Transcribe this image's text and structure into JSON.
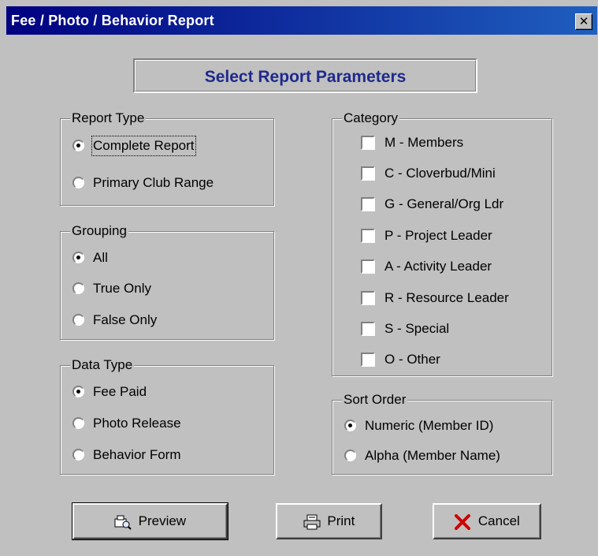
{
  "window": {
    "title": "Fee / Photo / Behavior Report",
    "close_glyph": "✕"
  },
  "heading": "Select Report Parameters",
  "report_type": {
    "legend": "Report Type",
    "options": [
      {
        "label": "Complete Report",
        "selected": true
      },
      {
        "label": "Primary Club Range",
        "selected": false
      }
    ]
  },
  "grouping": {
    "legend": "Grouping",
    "options": [
      {
        "label": "All",
        "selected": true
      },
      {
        "label": "True Only",
        "selected": false
      },
      {
        "label": "False Only",
        "selected": false
      }
    ]
  },
  "data_type": {
    "legend": "Data Type",
    "options": [
      {
        "label": "Fee Paid",
        "selected": true
      },
      {
        "label": "Photo Release",
        "selected": false
      },
      {
        "label": "Behavior Form",
        "selected": false
      }
    ]
  },
  "category": {
    "legend": "Category",
    "items": [
      {
        "label": "M - Members",
        "checked": false
      },
      {
        "label": "C - Cloverbud/Mini",
        "checked": false
      },
      {
        "label": "G - General/Org Ldr",
        "checked": false
      },
      {
        "label": "P - Project Leader",
        "checked": false
      },
      {
        "label": "A - Activity Leader",
        "checked": false
      },
      {
        "label": "R - Resource Leader",
        "checked": false
      },
      {
        "label": "S - Special",
        "checked": false
      },
      {
        "label": "O - Other",
        "checked": false
      }
    ]
  },
  "sort_order": {
    "legend": "Sort Order",
    "options": [
      {
        "label": "Numeric (Member ID)",
        "selected": true
      },
      {
        "label": "Alpha (Member Name)",
        "selected": false
      }
    ]
  },
  "buttons": {
    "preview": {
      "label": "Preview",
      "icon": "preview-icon"
    },
    "print": {
      "label": "Print",
      "icon": "printer-icon"
    },
    "cancel": {
      "label": "Cancel",
      "icon": "red-x-icon",
      "icon_color": "#cc0000"
    }
  }
}
